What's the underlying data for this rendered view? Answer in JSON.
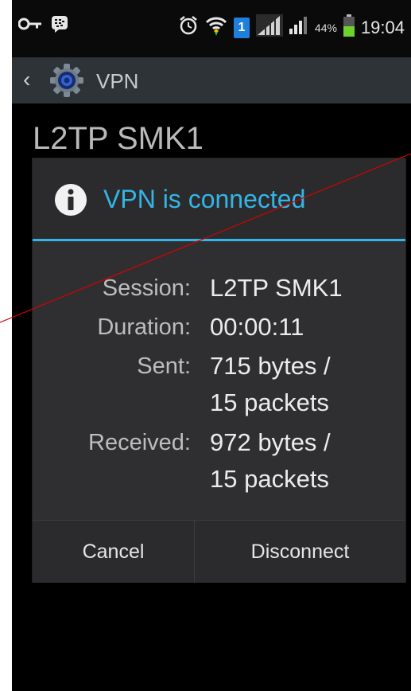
{
  "status_bar": {
    "battery_percent": "44%",
    "time": "19:04",
    "sim_badge": "1",
    "icons": [
      "vpn-key-icon",
      "bbm-icon",
      "alarm-icon",
      "wifi-icon",
      "sim-icon",
      "signal-icon",
      "signal-icon",
      "battery-icon"
    ]
  },
  "action_bar": {
    "title": "VPN",
    "back_icon": "chevron-left-icon",
    "app_icon": "gear-icon"
  },
  "page": {
    "title": "L2TP SMK1"
  },
  "dialog": {
    "title": "VPN is connected",
    "title_icon": "info-icon",
    "rows": [
      {
        "label": "Session:",
        "value_lines": [
          "L2TP SMK1"
        ]
      },
      {
        "label": "Duration:",
        "value_lines": [
          "00:00:11"
        ]
      },
      {
        "label": "Sent:",
        "value_lines": [
          "715 bytes /",
          "15 packets"
        ]
      },
      {
        "label": "Received:",
        "value_lines": [
          "972 bytes /",
          "15 packets"
        ]
      }
    ],
    "buttons": {
      "cancel": "Cancel",
      "disconnect": "Disconnect"
    }
  },
  "colors": {
    "accent": "#33b5e5",
    "annotation": "#d40000"
  }
}
